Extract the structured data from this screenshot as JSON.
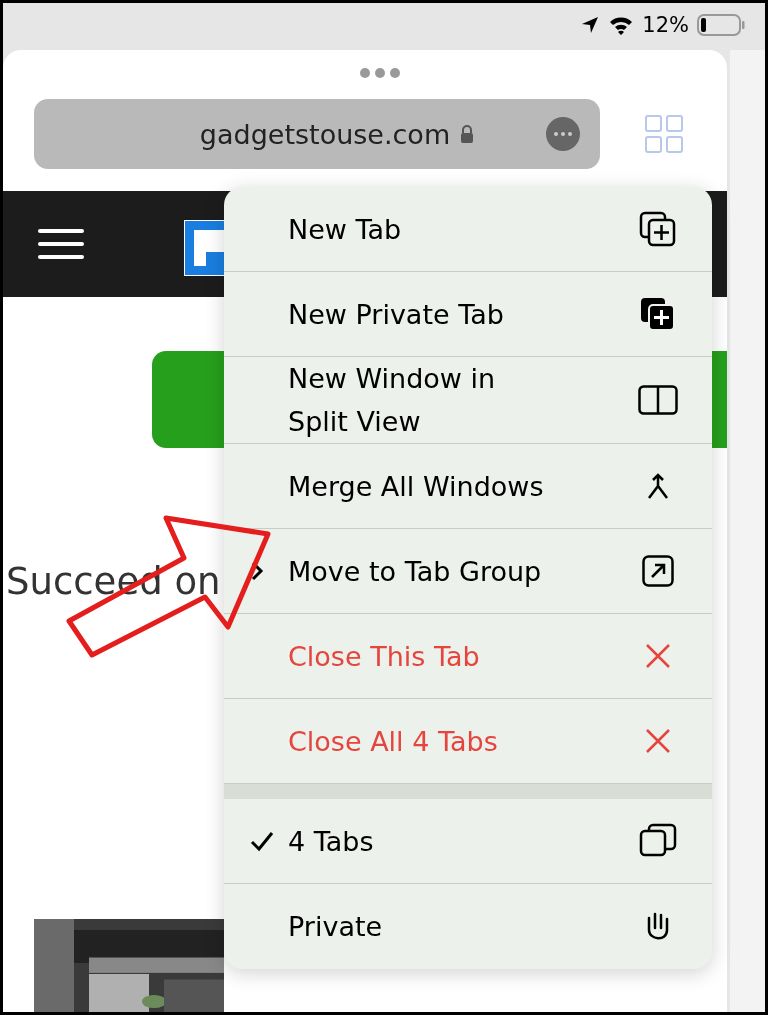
{
  "status_bar": {
    "battery": "12%"
  },
  "browser": {
    "address": "gadgetstouse.com",
    "page_text": "Succeed on"
  },
  "menu": {
    "sections": [
      [
        {
          "kind": "new-tab",
          "label": "New Tab",
          "destructive": false,
          "submenu": false
        },
        {
          "kind": "private-tab",
          "label": "New Private Tab",
          "destructive": false,
          "submenu": false
        },
        {
          "kind": "split",
          "label": "New Window in Split View",
          "destructive": false,
          "submenu": false
        },
        {
          "kind": "merge",
          "label": "Merge All Windows",
          "destructive": false,
          "submenu": false
        },
        {
          "kind": "move",
          "label": "Move to Tab Group",
          "destructive": false,
          "submenu": true
        },
        {
          "kind": "close",
          "label": "Close This Tab",
          "destructive": true,
          "submenu": false
        },
        {
          "kind": "close",
          "label": "Close All 4 Tabs",
          "destructive": true,
          "submenu": false
        }
      ],
      [
        {
          "kind": "tabs",
          "label": "4 Tabs",
          "checked": true
        },
        {
          "kind": "private",
          "label": "Private",
          "checked": false
        }
      ]
    ]
  }
}
